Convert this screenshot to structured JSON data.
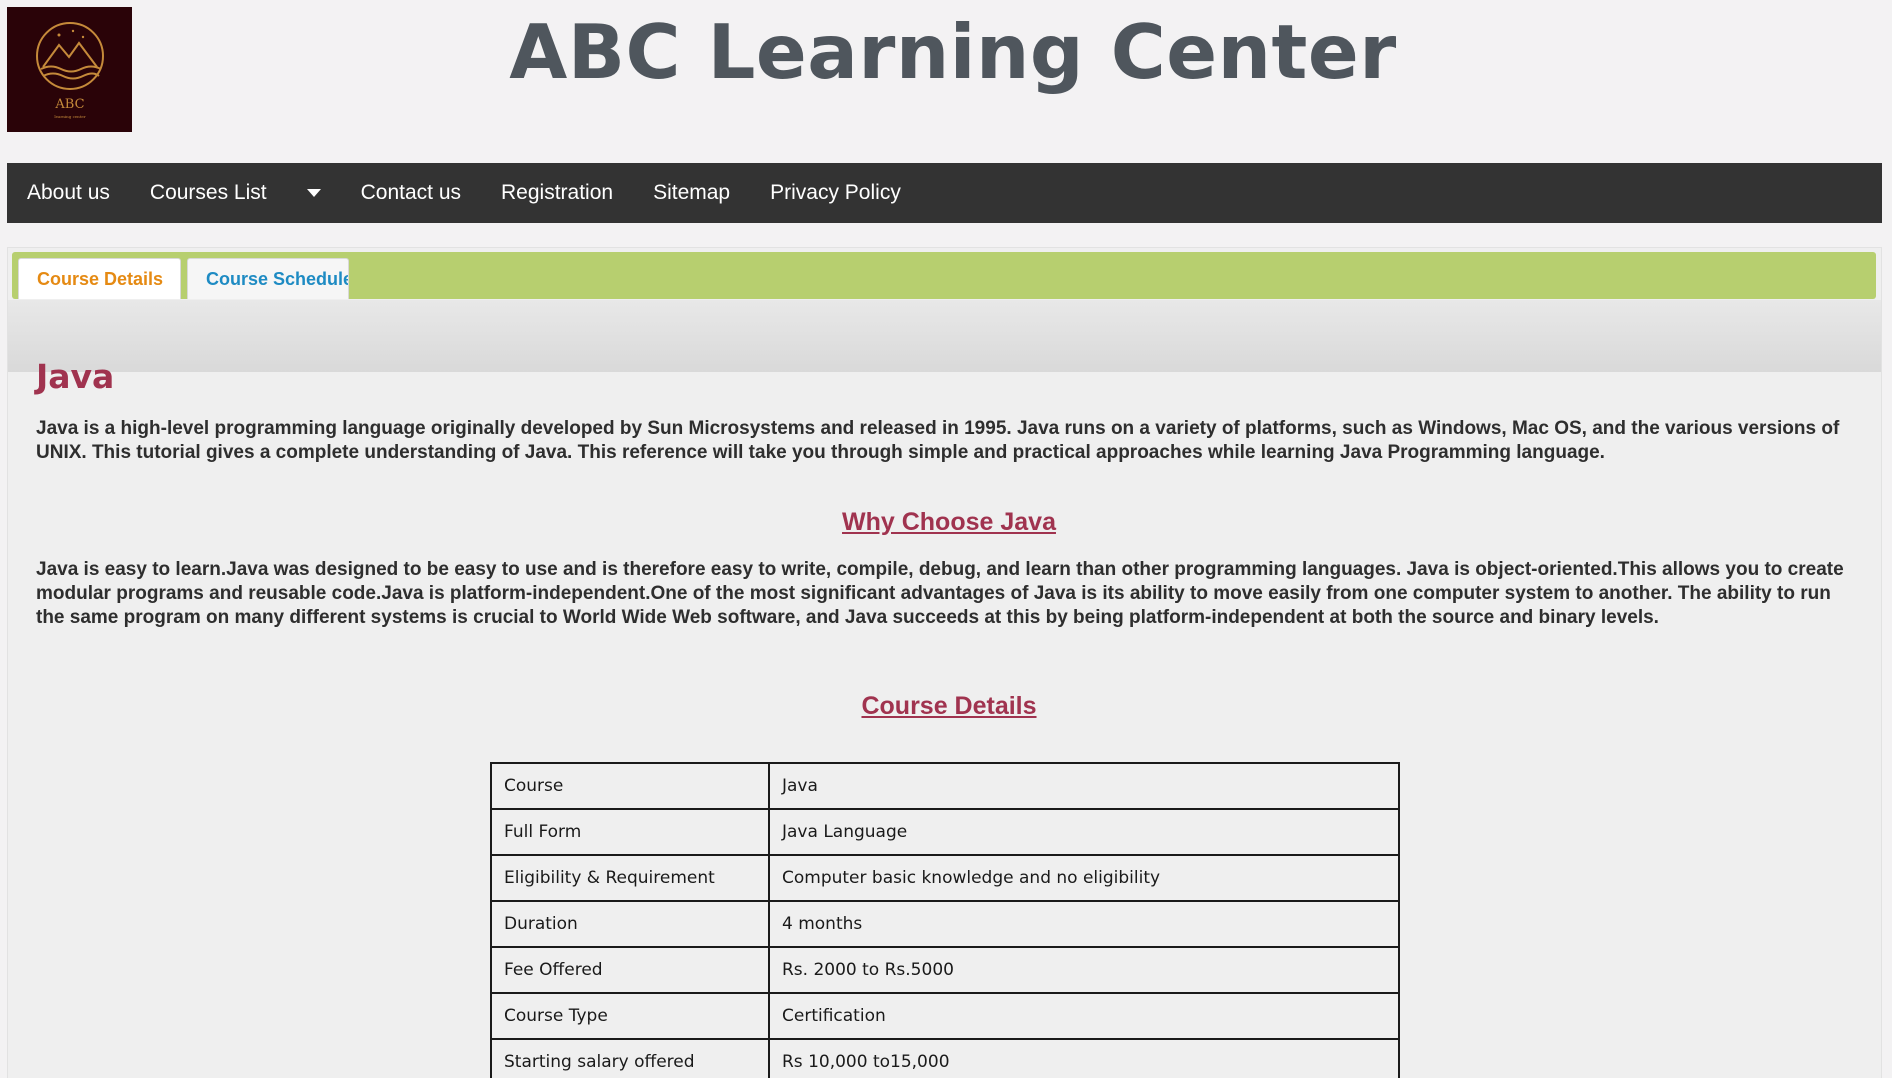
{
  "header": {
    "logo": {
      "icon": "mountain-sunrise-logo-icon",
      "text": "ABC",
      "subtext": "learning center"
    },
    "title": "ABC Learning Center"
  },
  "nav": {
    "items": [
      "About us",
      "Courses List",
      "Contact us",
      "Registration",
      "Sitemap",
      "Privacy Policy"
    ],
    "dropdown_icon": "caret-down-icon"
  },
  "tabs": {
    "active": "Course Details",
    "inactive": "Course Schedule"
  },
  "content": {
    "course_title": "Java",
    "intro": "Java is a high-level programming language originally developed by Sun Microsystems and released in 1995. Java runs on a variety of platforms, such as Windows, Mac OS, and the various versions of UNIX. This tutorial gives a complete understanding of Java. This reference will take you through simple and practical approaches while learning Java Programming language.",
    "why_heading": "Why Choose Java",
    "why_text": "Java is easy to learn.Java was designed to be easy to use and is therefore easy to write, compile, debug, and learn than other programming languages. Java is object-oriented.This allows you to create modular programs and reusable code.Java is platform-independent.One of the most significant advantages of Java is its ability to move easily from one computer system to another. The ability to run the same program on many different systems is crucial to World Wide Web software, and Java succeeds at this by being platform-independent at both the source and binary levels.",
    "details_heading": "Course Details"
  },
  "details_table": [
    {
      "key": "Course",
      "value": "Java"
    },
    {
      "key": "Full Form",
      "value": "Java Language"
    },
    {
      "key": "Eligibility & Requirement",
      "value": "Computer basic knowledge and no eligibility"
    },
    {
      "key": "Duration",
      "value": "4 months"
    },
    {
      "key": "Fee Offered",
      "value": "Rs. 2000 to Rs.5000"
    },
    {
      "key": "Course Type",
      "value": "Certification"
    },
    {
      "key": "Starting salary offered",
      "value": "Rs 10,000 to15,000"
    }
  ],
  "colors": {
    "nav_bg": "#333333",
    "tab_bar": "#b7cf6f",
    "heading": "#a0334f",
    "active_tab": "#e58a13",
    "inactive_tab": "#1e8bc3"
  }
}
